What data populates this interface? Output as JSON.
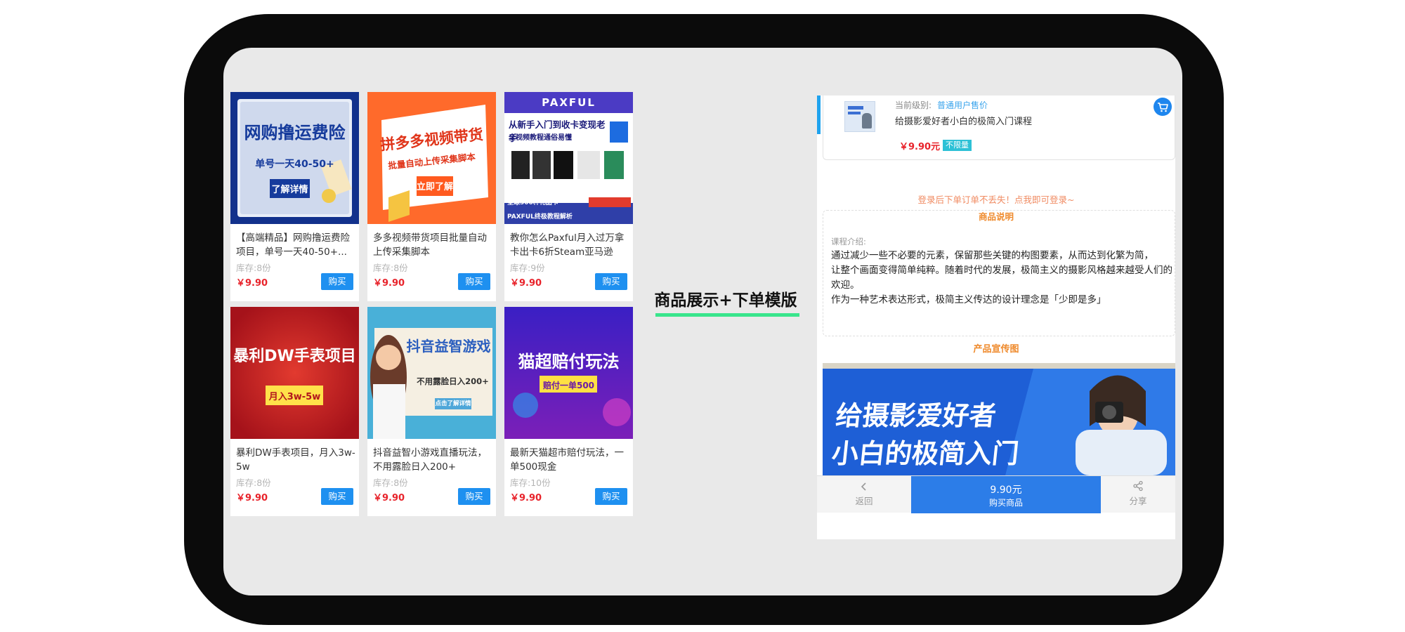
{
  "colors": {
    "accent_blue": "#1e90f0",
    "price_red": "#e8232b",
    "highlight_green": "#39e58c",
    "section_orange": "#ef8a2c"
  },
  "products": [
    {
      "poster_lines": [
        "网购撸运费险",
        "单号一天40-50+",
        "了解详情"
      ],
      "title": "【高端精品】网购撸运费险项目，单号一天40-50+...",
      "stock": "库存:8份",
      "price": "￥9.90",
      "buy_label": "购买"
    },
    {
      "poster_lines": [
        "拼多多视频带货",
        "批量自动上传采集脚本",
        "立即了解"
      ],
      "title": "多多视频带货项目批量自动上传采集脚本",
      "stock": "库存:8份",
      "price": "￥9.90",
      "buy_label": "购买"
    },
    {
      "poster_lines": [
        "PAXFUL",
        "从新手入门到收卡变现老手",
        "全视频教程通俗易懂",
        "PAXFUL终极教程解析",
        "全球300种礼品卡"
      ],
      "title": "教你怎么Paxful月入过万拿卡出卡6折Steam亚马逊",
      "stock": "库存:9份",
      "price": "￥9.90",
      "buy_label": "购买"
    },
    {
      "poster_lines": [
        "暴利DW手表项目",
        "月入3w-5w"
      ],
      "title": "暴利DW手表项目，月入3w-5w",
      "stock": "库存:8份",
      "price": "￥9.90",
      "buy_label": "购买"
    },
    {
      "poster_lines": [
        "抖音益智游戏",
        "不用露脸日入200+",
        "点击了解详情"
      ],
      "title": "抖音益智小游戏直播玩法，不用露脸日入200+",
      "stock": "库存:8份",
      "price": "￥9.90",
      "buy_label": "购买"
    },
    {
      "poster_lines": [
        "猫超赔付玩法",
        "赔付一单500"
      ],
      "title": "最新天猫超市赔付玩法，一单500现金",
      "stock": "库存:10份",
      "price": "￥9.90",
      "buy_label": "购买"
    }
  ],
  "center_label": "商品展示+下单模版",
  "detail": {
    "level_label": "当前级别:",
    "level_value": "普通用户售价",
    "product_name": "给摄影爱好者小白的极简入门课程",
    "price": "￥9.90元",
    "limit_badge": "不限量",
    "login_tip": "登录后下单订单不丢失！点我即可登录~",
    "desc_heading": "商品说明",
    "course_label": "课程介绍:",
    "desc_lines": [
      "通过减少一些不必要的元素，保留那些关键的构图要素，从而达到化繁为简，",
      "让整个画面变得简单纯粹。随着时代的发展，极简主义的摄影风格越来越受人们的",
      "欢迎。",
      "作为一种艺术表达形式，极简主义传达的设计理念是「少即是多」"
    ],
    "promo_heading": "产品宣传图",
    "promo_lines": [
      "给摄影爱好者",
      "小白的极简入门"
    ],
    "back_label": "返回",
    "buy_price": "9.90元",
    "buy_label": "购买商品",
    "share_label": "分享"
  }
}
